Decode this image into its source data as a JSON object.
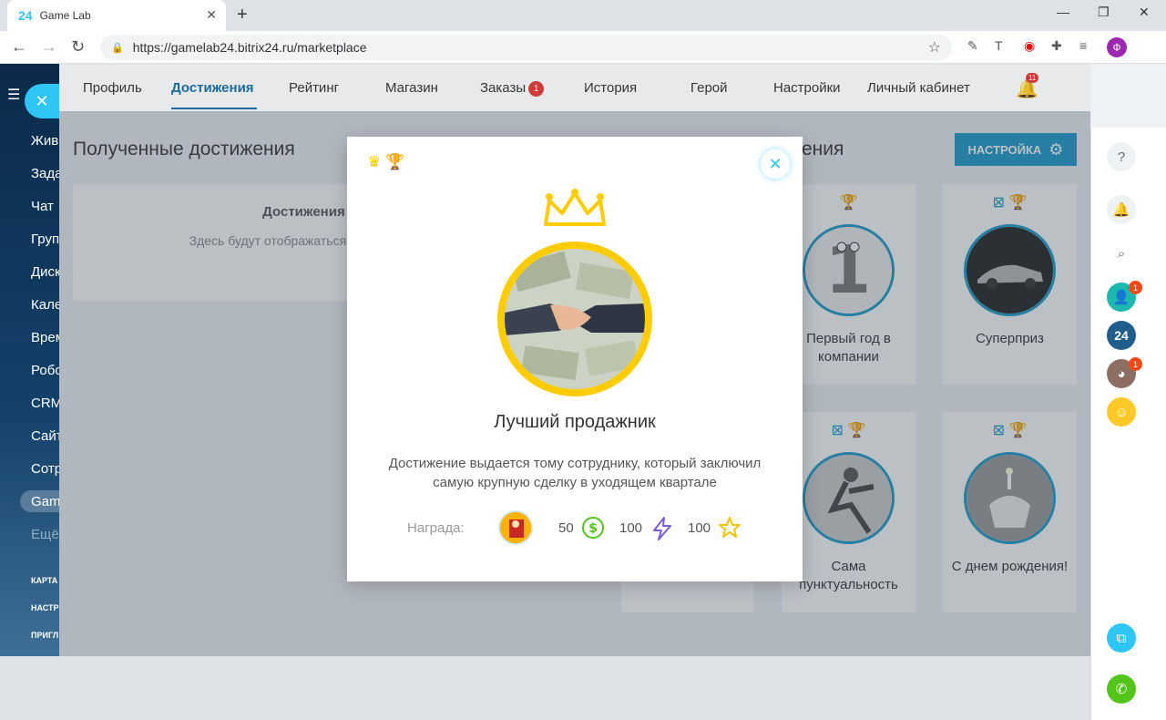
{
  "browser": {
    "tab_title": "Game Lab",
    "tab_favicon": "24",
    "url": "https://gamelab24.bitrix24.ru/marketplace",
    "profile_letter": "Ф"
  },
  "left_menu": {
    "items": [
      "Жив",
      "Зада",
      "Чат",
      "Груп",
      "Диск",
      "Кале",
      "Врем",
      "Робо",
      "CRM",
      "Сайт",
      "Сотр",
      "Gam",
      "Ещё"
    ],
    "small_items": [
      "КАРТА",
      "НАСТР",
      "ПРИГЛ"
    ]
  },
  "nav": {
    "tabs": [
      "Профиль",
      "Достижения",
      "Рейтинг",
      "Магазин",
      "Заказы",
      "История",
      "Герой",
      "Настройки",
      "Личный кабинет"
    ],
    "orders_badge": "1",
    "bell_badge": "11"
  },
  "received": {
    "title": "Полученные достижения",
    "empty_title": "Достижения не пол",
    "empty_text": "Здесь будут отображаться д которые вы получ"
  },
  "available": {
    "title_tail": "ения",
    "settings_label": "НАСТРОЙКА",
    "cards": [
      {
        "name": "Первый год в компании"
      },
      {
        "name": "Суперприз"
      },
      {
        "name": "Сама пунктуальность"
      },
      {
        "name": "С днем рождения!"
      }
    ]
  },
  "right_panel": {
    "badges": [
      "1",
      "1"
    ],
    "logo_label": "24"
  },
  "modal": {
    "title": "Лучший продажник",
    "description": "Достижение выдается тому сотруднику, который заключил самую крупную сделку в уходящем квартале",
    "reward_label": "Награда:",
    "coins": "50",
    "energy": "100",
    "stars": "100",
    "colors": {
      "gold": "#ffcc00",
      "accent": "#2fc6f6",
      "coin": "#52c41a",
      "energy": "#7b5bd6"
    }
  }
}
